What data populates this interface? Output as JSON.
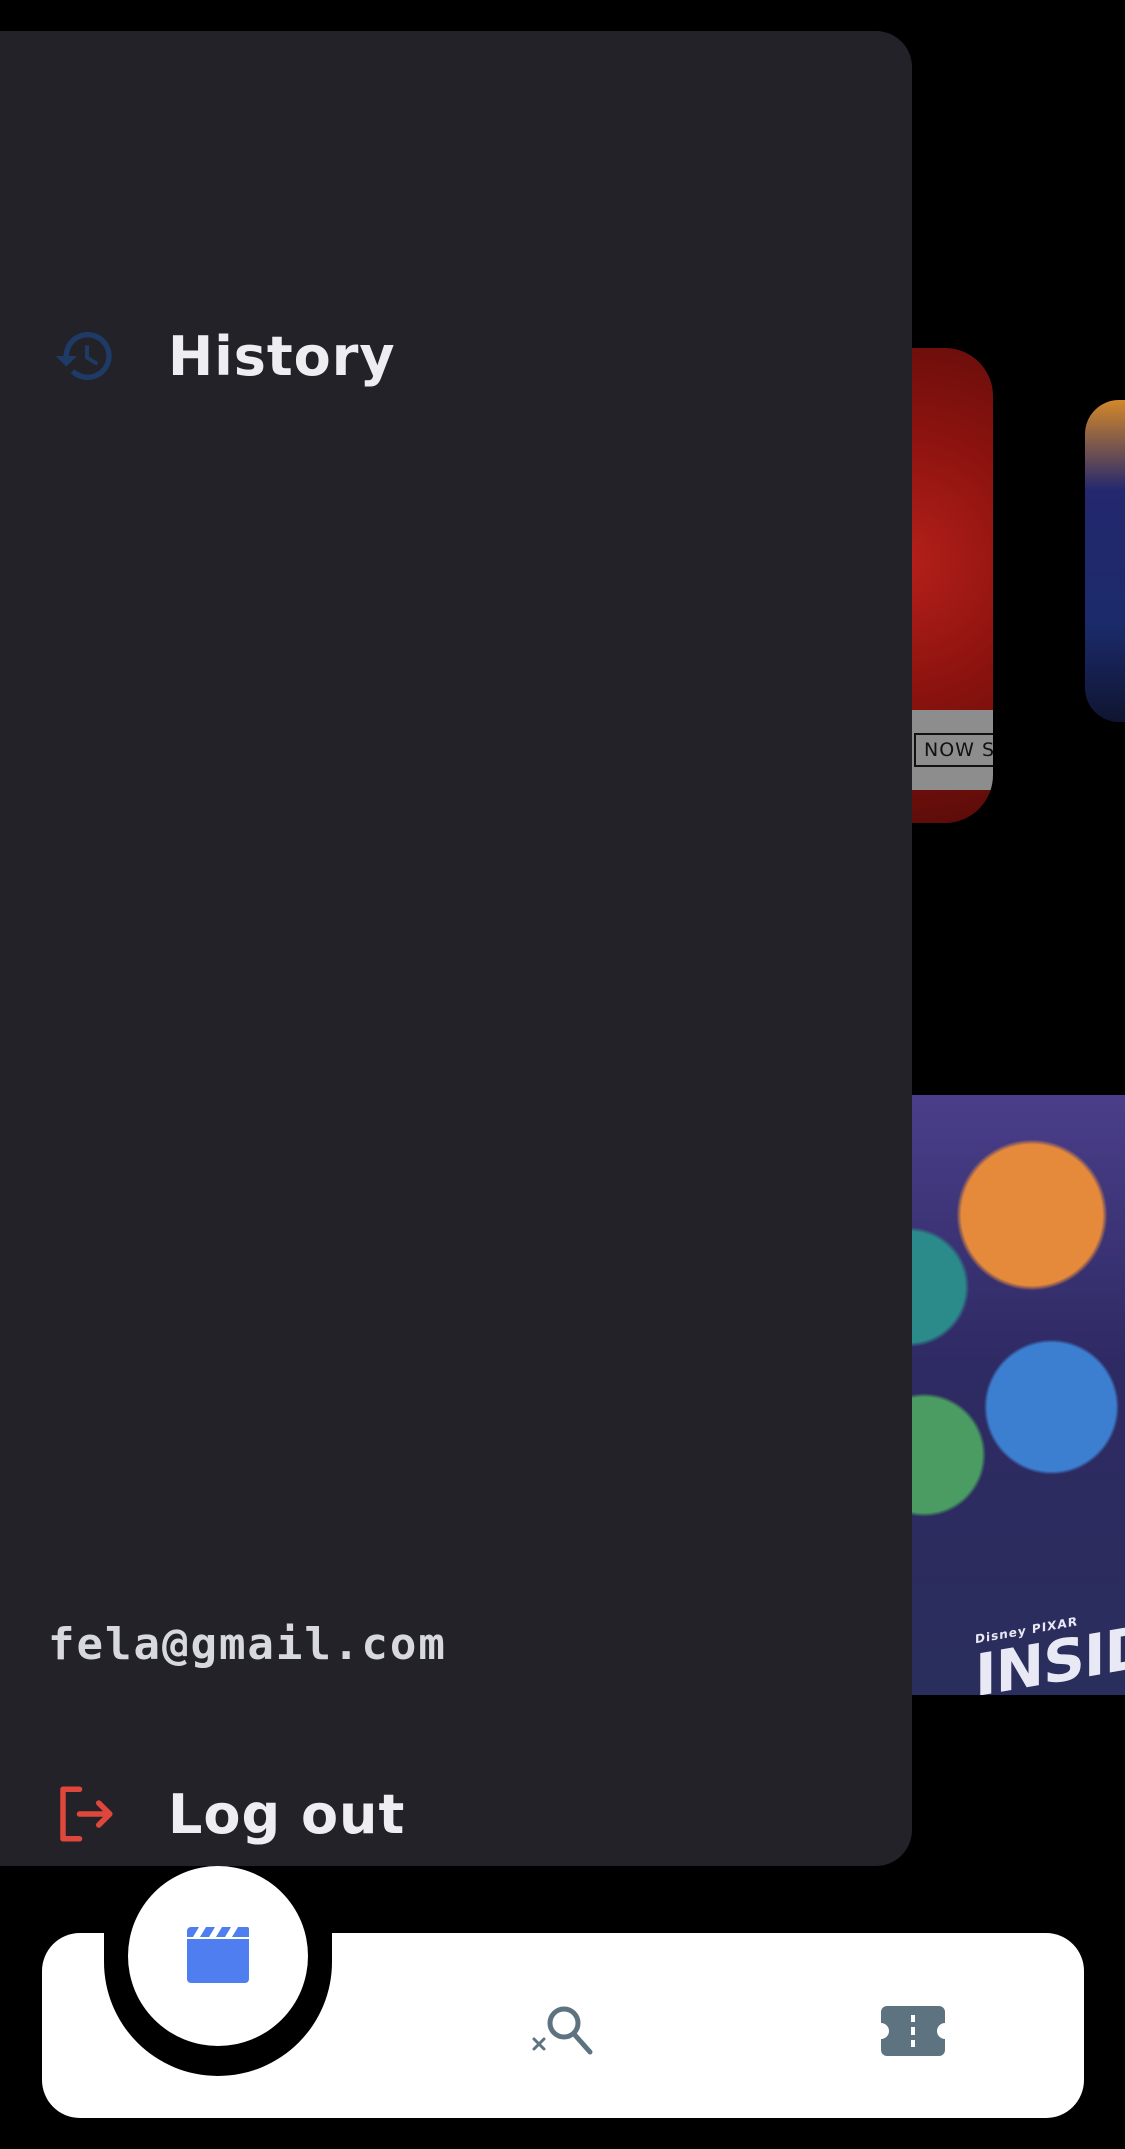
{
  "background_posters": {
    "red_poster_banner": "NOW S",
    "inside_out_brand": "Disney PIXAR",
    "inside_out_title": "INSIDE OUT"
  },
  "drawer": {
    "history_label": "History",
    "user_email": "fela@gmail.com",
    "logout_label": "Log out"
  },
  "bottom_nav": {
    "items": [
      {
        "icon": "clapperboard-icon",
        "active": true
      },
      {
        "icon": "search-icon",
        "active": false
      },
      {
        "icon": "ticket-icon",
        "active": false
      }
    ]
  },
  "colors": {
    "drawer_bg": "#232229",
    "history_icon": "#1e3b66",
    "logout_icon": "#e0473c",
    "active_nav": "#4f7ef0",
    "inactive_nav": "#5e7380"
  }
}
